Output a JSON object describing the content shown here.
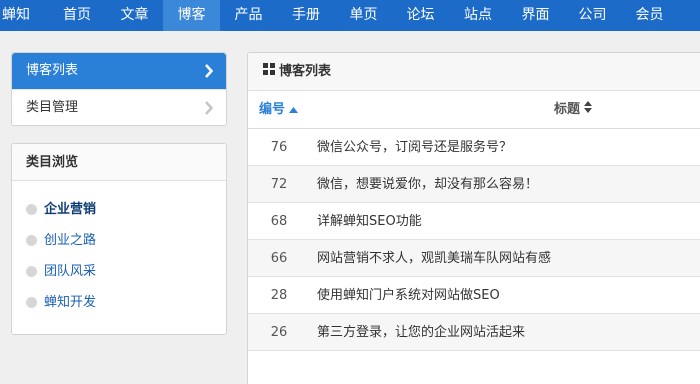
{
  "nav": {
    "brand": "蝉知",
    "items": [
      {
        "label": "首页",
        "active": false
      },
      {
        "label": "文章",
        "active": false
      },
      {
        "label": "博客",
        "active": true
      },
      {
        "label": "产品",
        "active": false
      },
      {
        "label": "手册",
        "active": false
      },
      {
        "label": "单页",
        "active": false
      },
      {
        "label": "论坛",
        "active": false
      },
      {
        "label": "站点",
        "active": false
      },
      {
        "label": "界面",
        "active": false
      },
      {
        "label": "公司",
        "active": false
      },
      {
        "label": "会员",
        "active": false
      }
    ]
  },
  "sidemenu": {
    "items": [
      {
        "label": "博客列表",
        "active": true
      },
      {
        "label": "类目管理",
        "active": false
      }
    ]
  },
  "categories": {
    "title": "类目浏览",
    "items": [
      {
        "label": "企业营销",
        "active": true
      },
      {
        "label": "创业之路",
        "active": false
      },
      {
        "label": "团队风采",
        "active": false
      },
      {
        "label": "蝉知开发",
        "active": false
      }
    ]
  },
  "panel": {
    "title": "博客列表",
    "columns": {
      "id": "编号",
      "title": "标题"
    },
    "rows": [
      {
        "id": "76",
        "title": "微信公众号，订阅号还是服务号？"
      },
      {
        "id": "72",
        "title": "微信，想要说爱你，却没有那么容易！"
      },
      {
        "id": "68",
        "title": "详解蝉知SEO功能"
      },
      {
        "id": "66",
        "title": "网站营销不求人，观凯美瑞车队网站有感"
      },
      {
        "id": "28",
        "title": "使用蝉知门户系统对网站做SEO"
      },
      {
        "id": "26",
        "title": "第三方登录，让您的企业网站活起来"
      }
    ]
  },
  "colors": {
    "nav_bg": "#1c6bc9",
    "nav_active": "#3b87d9",
    "menu_active": "#2a7fd7",
    "link": "#1a5fb4"
  }
}
